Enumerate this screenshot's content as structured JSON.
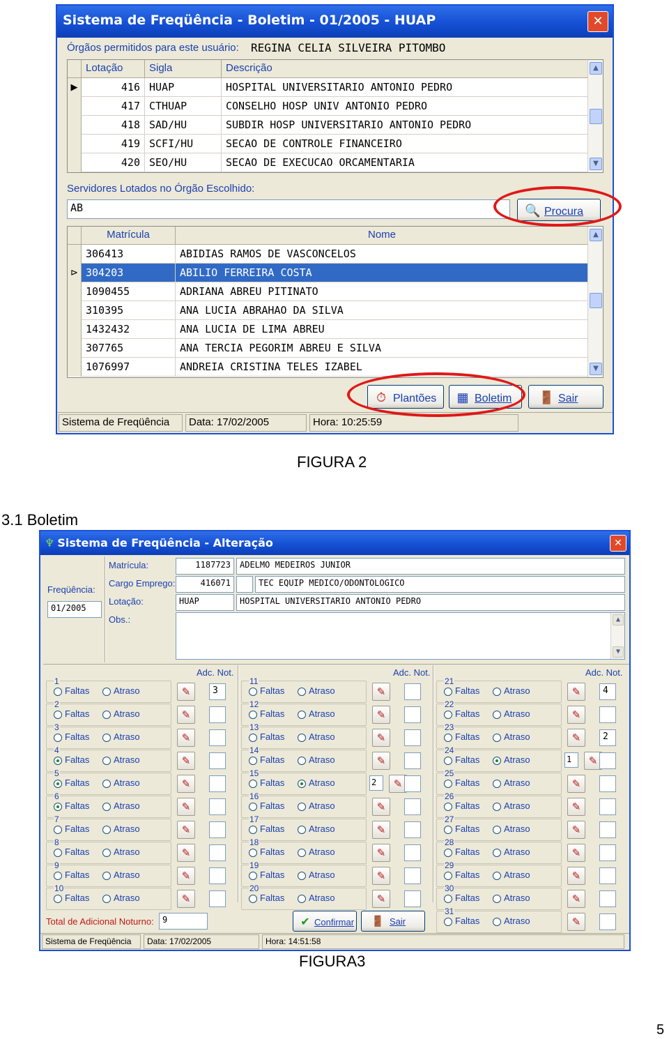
{
  "figure2": {
    "window_title": "Sistema de Freqüência - Boletim - 01/2005 - HUAP",
    "close_label": "✕",
    "orgs_label": "Órgãos permitidos para este usuário:",
    "user_name": "REGINA CELIA SILVEIRA PITOMBO",
    "orgs_columns": [
      "Lotação",
      "Sigla",
      "Descrição"
    ],
    "orgs_rows": [
      {
        "lotacao": "416",
        "sigla": "HUAP",
        "descricao": "HOSPITAL UNIVERSITARIO ANTONIO PEDRO"
      },
      {
        "lotacao": "417",
        "sigla": "CTHUAP",
        "descricao": "CONSELHO HOSP UNIV ANTONIO PEDRO"
      },
      {
        "lotacao": "418",
        "sigla": "SAD/HU",
        "descricao": "SUBDIR HOSP UNIVERSITARIO ANTONIO PEDRO"
      },
      {
        "lotacao": "419",
        "sigla": "SCFI/HU",
        "descricao": "SECAO DE CONTROLE FINANCEIRO"
      },
      {
        "lotacao": "420",
        "sigla": "SEO/HU",
        "descricao": "SECAO DE EXECUCAO ORCAMENTARIA"
      }
    ],
    "servers_label": "Servidores Lotados no Órgão Escolhido:",
    "search_value": "AB",
    "search_button": "Procura",
    "servers_columns": [
      "Matrícula",
      "Nome"
    ],
    "servers_rows": [
      {
        "matricula": "306413",
        "nome": "ABIDIAS RAMOS DE VASCONCELOS"
      },
      {
        "matricula": "304203",
        "nome": "ABILIO FERREIRA COSTA"
      },
      {
        "matricula": "1090455",
        "nome": "ADRIANA ABREU PITINATO"
      },
      {
        "matricula": "310395",
        "nome": "ANA LUCIA ABRAHAO DA SILVA"
      },
      {
        "matricula": "1432432",
        "nome": "ANA LUCIA DE LIMA ABREU"
      },
      {
        "matricula": "307765",
        "nome": "ANA TERCIA PEGORIM ABREU E SILVA"
      },
      {
        "matricula": "1076997",
        "nome": "ANDREIA CRISTINA TELES IZABEL"
      }
    ],
    "buttons": {
      "plantoes": "Plantões",
      "boletim": "Boletim",
      "sair": "Sair"
    },
    "status": {
      "app": "Sistema de Freqüência",
      "date": "Data: 17/02/2005",
      "time": "Hora: 10:25:59"
    },
    "caption": "FIGURA 2"
  },
  "section_heading": "3.1 Boletim",
  "figure3": {
    "window_title": "Sistema de Freqüência - Alteração",
    "close_label": "✕",
    "frequencia_label": "Freqüência:",
    "frequencia_value": "01/2005",
    "matricula_label": "Matrícula:",
    "matricula_value": "1187723",
    "name_value": "ADELMO MEDEIROS JUNIOR",
    "cargo_label": "Cargo Emprego:",
    "cargo_code": "416071",
    "cargo_value": "TEC EQUIP MEDICO/ODONTOLOGICO",
    "lotacao_label": "Lotação:",
    "lotacao_code": "HUAP",
    "lotacao_value": "HOSPITAL UNIVERSITARIO ANTONIO PEDRO",
    "obs_label": "Obs.:",
    "adc_header": "Adc. Not.",
    "faltas_label": "Faltas",
    "atraso_label": "Atraso",
    "edit_icon": "pencil-eraser-icon",
    "days": [
      {
        "n": "1",
        "sel": "",
        "atraso": "",
        "adc": "3"
      },
      {
        "n": "2",
        "sel": "",
        "atraso": "",
        "adc": ""
      },
      {
        "n": "3",
        "sel": "",
        "atraso": "",
        "adc": ""
      },
      {
        "n": "4",
        "sel": "faltas",
        "atraso": "",
        "adc": ""
      },
      {
        "n": "5",
        "sel": "faltas",
        "atraso": "",
        "adc": ""
      },
      {
        "n": "6",
        "sel": "faltas",
        "atraso": "",
        "adc": ""
      },
      {
        "n": "7",
        "sel": "",
        "atraso": "",
        "adc": ""
      },
      {
        "n": "8",
        "sel": "",
        "atraso": "",
        "adc": ""
      },
      {
        "n": "9",
        "sel": "",
        "atraso": "",
        "adc": ""
      },
      {
        "n": "10",
        "sel": "",
        "atraso": "",
        "adc": ""
      },
      {
        "n": "11",
        "sel": "",
        "atraso": "",
        "adc": ""
      },
      {
        "n": "12",
        "sel": "",
        "atraso": "",
        "adc": ""
      },
      {
        "n": "13",
        "sel": "",
        "atraso": "",
        "adc": ""
      },
      {
        "n": "14",
        "sel": "",
        "atraso": "",
        "adc": ""
      },
      {
        "n": "15",
        "sel": "atraso",
        "atraso": "2",
        "adc": ""
      },
      {
        "n": "16",
        "sel": "",
        "atraso": "",
        "adc": ""
      },
      {
        "n": "17",
        "sel": "",
        "atraso": "",
        "adc": ""
      },
      {
        "n": "18",
        "sel": "",
        "atraso": "",
        "adc": ""
      },
      {
        "n": "19",
        "sel": "",
        "atraso": "",
        "adc": ""
      },
      {
        "n": "20",
        "sel": "",
        "atraso": "",
        "adc": ""
      },
      {
        "n": "21",
        "sel": "",
        "atraso": "",
        "adc": "4"
      },
      {
        "n": "22",
        "sel": "",
        "atraso": "",
        "adc": ""
      },
      {
        "n": "23",
        "sel": "",
        "atraso": "",
        "adc": "2"
      },
      {
        "n": "24",
        "sel": "atraso",
        "atraso": "1",
        "adc": ""
      },
      {
        "n": "25",
        "sel": "",
        "atraso": "",
        "adc": ""
      },
      {
        "n": "26",
        "sel": "",
        "atraso": "",
        "adc": ""
      },
      {
        "n": "27",
        "sel": "",
        "atraso": "",
        "adc": ""
      },
      {
        "n": "28",
        "sel": "",
        "atraso": "",
        "adc": ""
      },
      {
        "n": "29",
        "sel": "",
        "atraso": "",
        "adc": ""
      },
      {
        "n": "30",
        "sel": "",
        "atraso": "",
        "adc": ""
      },
      {
        "n": "31",
        "sel": "",
        "atraso": "",
        "adc": ""
      }
    ],
    "total_label": "Total de Adicional Noturno:",
    "total_value": "9",
    "buttons": {
      "confirmar": "Confirmar",
      "sair": "Sair"
    },
    "status": {
      "app": "Sistema de Freqüência",
      "date": "Data: 17/02/2005",
      "time": "Hora: 14:51:58"
    },
    "caption": "FIGURA3"
  },
  "page_number": "5",
  "colors": {
    "title_blue": "#1550d4",
    "selection": "#316ac5",
    "highlight_ring": "#e01818",
    "label_blue": "#1a3fb0"
  }
}
